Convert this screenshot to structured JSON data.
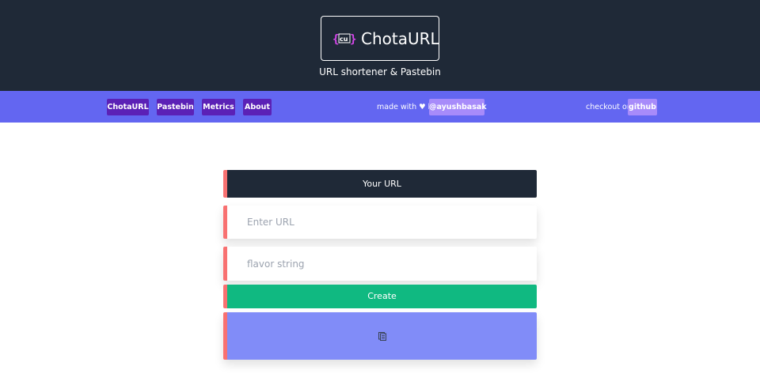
{
  "header": {
    "logo_mark_text": "{cu}",
    "logo_text": "ChotaURL",
    "tagline": "URL shortener & Pastebin"
  },
  "nav": {
    "items": [
      {
        "label": "ChotaURL"
      },
      {
        "label": "Pastebin"
      },
      {
        "label": "Metrics"
      },
      {
        "label": "About"
      }
    ],
    "made_with_text": "made with ♥ by",
    "author_badge": "@ayushbasak",
    "checkout_text": "checkout on",
    "github_badge": "github"
  },
  "form": {
    "title": "Your URL",
    "url_placeholder": "Enter URL",
    "flavor_placeholder": "flavor string",
    "create_label": "Create",
    "copy_icon": "clipboard-icon"
  },
  "colors": {
    "header_bg": "#1f2937",
    "nav_bg": "#6366f1",
    "nav_button": "#5b21b6",
    "badge": "#a78bfa",
    "accent_border": "#f87171",
    "create_bg": "#10b981",
    "result_bg": "#818cf8"
  }
}
